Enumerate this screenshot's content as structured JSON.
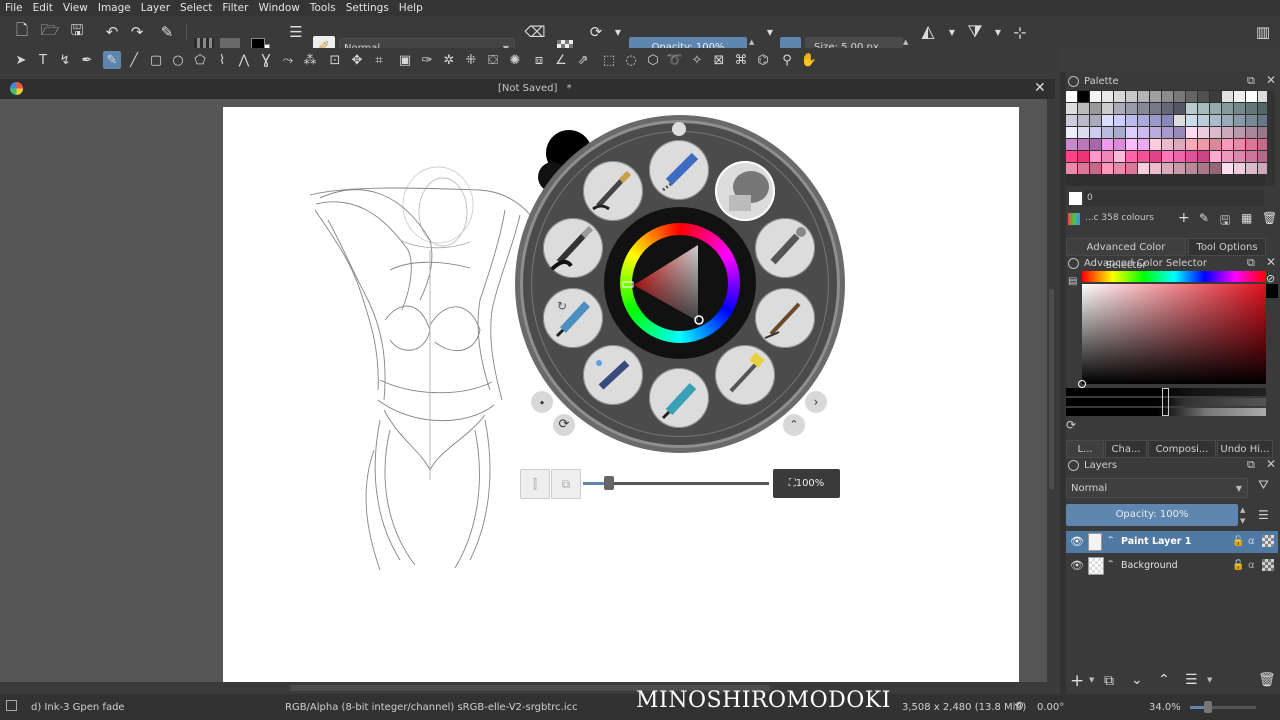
{
  "menu": [
    "File",
    "Edit",
    "View",
    "Image",
    "Layer",
    "Select",
    "Filter",
    "Window",
    "Tools",
    "Settings",
    "Help"
  ],
  "toolbar": {
    "blend_mode": "Normal",
    "opacity_label": "Opacity: 100%",
    "size_label": "Size: 5.00 px"
  },
  "document": {
    "tab_title": "[Not Saved]",
    "modified_marker": "*"
  },
  "popup_palette": {
    "zoom_label": "100%"
  },
  "palette_docker": {
    "title": "Palette",
    "current_index": "0",
    "colour_count": "...c 358 colours"
  },
  "color_docker": {
    "tabs": [
      "Advanced Color Selector",
      "Tool Options"
    ],
    "title": "Advanced Color Selector"
  },
  "layers_docker": {
    "tabs": [
      "L...",
      "Cha...",
      "Composi...",
      "Undo Hi..."
    ],
    "title": "Layers",
    "blend_mode": "Normal",
    "opacity_label": "Opacity:  100%",
    "layers": [
      {
        "name": "Paint Layer 1",
        "selected": true
      },
      {
        "name": "Background",
        "selected": false
      }
    ]
  },
  "status": {
    "brush_preset": "d) Ink-3 Gpen fade",
    "color_profile": "RGB/Alpha (8-bit integer/channel)  sRGB-elle-V2-srgbtrc.icc",
    "image_size": "3,508 x 2,480 (13.8 MiB)",
    "rotation": "0.00°",
    "zoom": "34.0%"
  },
  "watermark": "MINOSHIROMODOKI",
  "colors": {
    "accent": "#5f86ae",
    "selection": "#4f79a3",
    "paper": "#ffffff"
  }
}
